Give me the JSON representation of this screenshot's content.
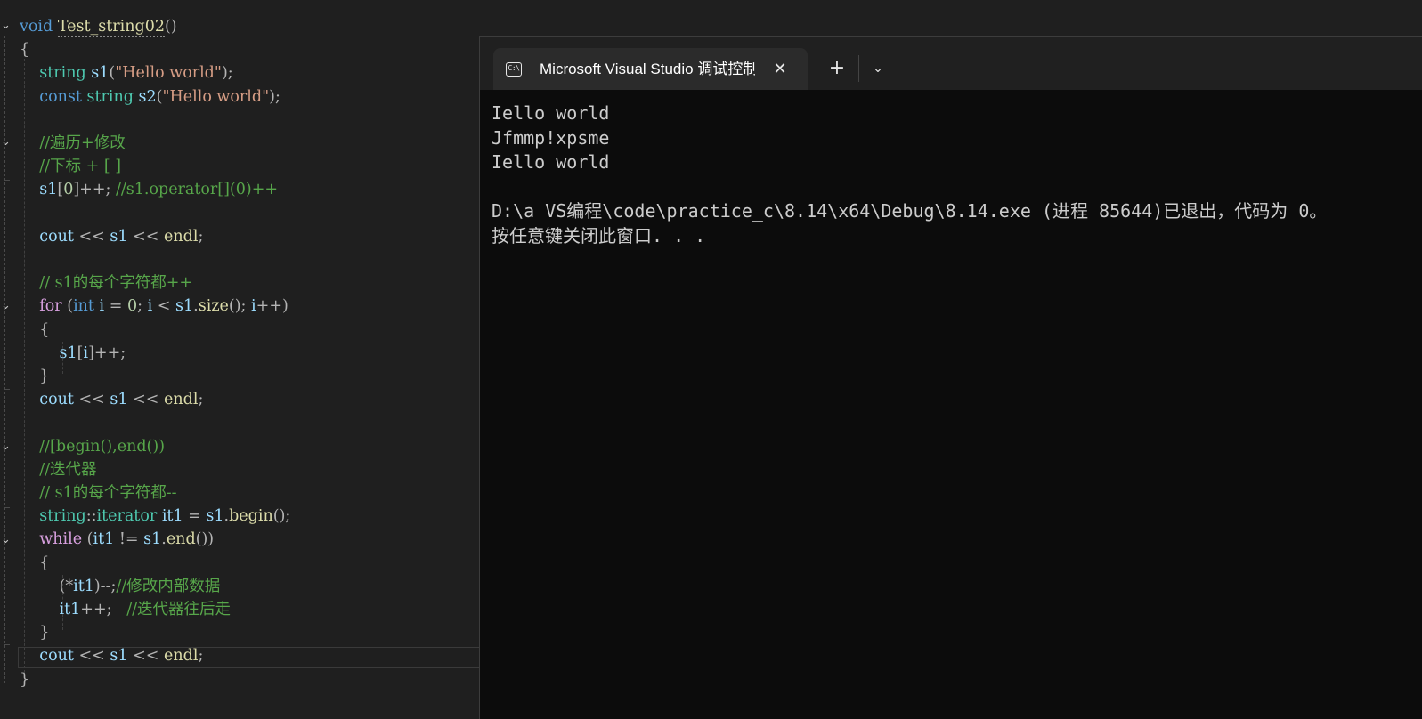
{
  "editor": {
    "lines": [
      [
        {
          "c": "kw",
          "t": "void"
        },
        {
          "c": "",
          "t": " "
        },
        {
          "c": "fn fn-underline",
          "t": "Test_string02"
        },
        {
          "c": "op",
          "t": "()"
        }
      ],
      [
        {
          "c": "op",
          "t": "{"
        }
      ],
      [
        {
          "c": "",
          "t": "    "
        },
        {
          "c": "ty",
          "t": "string"
        },
        {
          "c": "",
          "t": " "
        },
        {
          "c": "var",
          "t": "s1"
        },
        {
          "c": "op",
          "t": "("
        },
        {
          "c": "str",
          "t": "\"Hello world\""
        },
        {
          "c": "op",
          "t": ");"
        }
      ],
      [
        {
          "c": "",
          "t": "    "
        },
        {
          "c": "kw",
          "t": "const"
        },
        {
          "c": "",
          "t": " "
        },
        {
          "c": "ty",
          "t": "string"
        },
        {
          "c": "",
          "t": " "
        },
        {
          "c": "var",
          "t": "s2"
        },
        {
          "c": "op",
          "t": "("
        },
        {
          "c": "str",
          "t": "\"Hello world\""
        },
        {
          "c": "op",
          "t": ");"
        }
      ],
      [],
      [
        {
          "c": "",
          "t": "    "
        },
        {
          "c": "cm",
          "t": "//遍历+修改"
        }
      ],
      [
        {
          "c": "",
          "t": "    "
        },
        {
          "c": "cm",
          "t": "//下标 + [ ]"
        }
      ],
      [
        {
          "c": "",
          "t": "    "
        },
        {
          "c": "var",
          "t": "s1"
        },
        {
          "c": "op",
          "t": "["
        },
        {
          "c": "num",
          "t": "0"
        },
        {
          "c": "op",
          "t": "]++; "
        },
        {
          "c": "cm",
          "t": "//s1.operator[](0)++"
        }
      ],
      [],
      [
        {
          "c": "",
          "t": "    "
        },
        {
          "c": "var",
          "t": "cout"
        },
        {
          "c": "",
          "t": " "
        },
        {
          "c": "op",
          "t": "<<"
        },
        {
          "c": "",
          "t": " "
        },
        {
          "c": "var",
          "t": "s1"
        },
        {
          "c": "",
          "t": " "
        },
        {
          "c": "op",
          "t": "<<"
        },
        {
          "c": "",
          "t": " "
        },
        {
          "c": "fn",
          "t": "endl"
        },
        {
          "c": "op",
          "t": ";"
        }
      ],
      [],
      [
        {
          "c": "",
          "t": "    "
        },
        {
          "c": "cm",
          "t": "// s1的每个字符都++"
        }
      ],
      [
        {
          "c": "",
          "t": "    "
        },
        {
          "c": "ctl",
          "t": "for"
        },
        {
          "c": "",
          "t": " "
        },
        {
          "c": "op",
          "t": "("
        },
        {
          "c": "kw",
          "t": "int"
        },
        {
          "c": "",
          "t": " "
        },
        {
          "c": "var",
          "t": "i"
        },
        {
          "c": "",
          "t": " "
        },
        {
          "c": "op",
          "t": "="
        },
        {
          "c": "",
          "t": " "
        },
        {
          "c": "num",
          "t": "0"
        },
        {
          "c": "op",
          "t": ";"
        },
        {
          "c": "",
          "t": " "
        },
        {
          "c": "var",
          "t": "i"
        },
        {
          "c": "",
          "t": " "
        },
        {
          "c": "op",
          "t": "<"
        },
        {
          "c": "",
          "t": " "
        },
        {
          "c": "var",
          "t": "s1"
        },
        {
          "c": "op",
          "t": "."
        },
        {
          "c": "fn",
          "t": "size"
        },
        {
          "c": "op",
          "t": "();"
        },
        {
          "c": "",
          "t": " "
        },
        {
          "c": "var",
          "t": "i"
        },
        {
          "c": "op",
          "t": "++)"
        }
      ],
      [
        {
          "c": "",
          "t": "    "
        },
        {
          "c": "op",
          "t": "{"
        }
      ],
      [
        {
          "c": "",
          "t": "        "
        },
        {
          "c": "var",
          "t": "s1"
        },
        {
          "c": "op",
          "t": "["
        },
        {
          "c": "var",
          "t": "i"
        },
        {
          "c": "op",
          "t": "]++;"
        }
      ],
      [
        {
          "c": "",
          "t": "    "
        },
        {
          "c": "op",
          "t": "}"
        }
      ],
      [
        {
          "c": "",
          "t": "    "
        },
        {
          "c": "var",
          "t": "cout"
        },
        {
          "c": "",
          "t": " "
        },
        {
          "c": "op",
          "t": "<<"
        },
        {
          "c": "",
          "t": " "
        },
        {
          "c": "var",
          "t": "s1"
        },
        {
          "c": "",
          "t": " "
        },
        {
          "c": "op",
          "t": "<<"
        },
        {
          "c": "",
          "t": " "
        },
        {
          "c": "fn",
          "t": "endl"
        },
        {
          "c": "op",
          "t": ";"
        }
      ],
      [],
      [
        {
          "c": "",
          "t": "    "
        },
        {
          "c": "cm",
          "t": "//[begin(),end())"
        }
      ],
      [
        {
          "c": "",
          "t": "    "
        },
        {
          "c": "cm",
          "t": "//迭代器"
        }
      ],
      [
        {
          "c": "",
          "t": "    "
        },
        {
          "c": "cm",
          "t": "// s1的每个字符都--"
        }
      ],
      [
        {
          "c": "",
          "t": "    "
        },
        {
          "c": "ty",
          "t": "string"
        },
        {
          "c": "op",
          "t": "::"
        },
        {
          "c": "ty",
          "t": "iterator"
        },
        {
          "c": "",
          "t": " "
        },
        {
          "c": "var",
          "t": "it1"
        },
        {
          "c": "",
          "t": " "
        },
        {
          "c": "op",
          "t": "="
        },
        {
          "c": "",
          "t": " "
        },
        {
          "c": "var",
          "t": "s1"
        },
        {
          "c": "op",
          "t": "."
        },
        {
          "c": "fn",
          "t": "begin"
        },
        {
          "c": "op",
          "t": "();"
        }
      ],
      [
        {
          "c": "",
          "t": "    "
        },
        {
          "c": "ctl",
          "t": "while"
        },
        {
          "c": "",
          "t": " "
        },
        {
          "c": "op",
          "t": "("
        },
        {
          "c": "var",
          "t": "it1"
        },
        {
          "c": "",
          "t": " "
        },
        {
          "c": "op",
          "t": "!="
        },
        {
          "c": "",
          "t": " "
        },
        {
          "c": "var",
          "t": "s1"
        },
        {
          "c": "op",
          "t": "."
        },
        {
          "c": "fn",
          "t": "end"
        },
        {
          "c": "op",
          "t": "())"
        }
      ],
      [
        {
          "c": "",
          "t": "    "
        },
        {
          "c": "op",
          "t": "{"
        }
      ],
      [
        {
          "c": "",
          "t": "        "
        },
        {
          "c": "op",
          "t": "(*"
        },
        {
          "c": "var",
          "t": "it1"
        },
        {
          "c": "op",
          "t": ")--;"
        },
        {
          "c": "cm",
          "t": "//修改内部数据"
        }
      ],
      [
        {
          "c": "",
          "t": "        "
        },
        {
          "c": "var",
          "t": "it1"
        },
        {
          "c": "op",
          "t": "++;"
        },
        {
          "c": "",
          "t": "   "
        },
        {
          "c": "cm",
          "t": "//迭代器往后走"
        }
      ],
      [
        {
          "c": "",
          "t": "    "
        },
        {
          "c": "op",
          "t": "}"
        }
      ],
      [
        {
          "c": "",
          "t": "    "
        },
        {
          "c": "var",
          "t": "cout"
        },
        {
          "c": "",
          "t": " "
        },
        {
          "c": "op",
          "t": "<<"
        },
        {
          "c": "",
          "t": " "
        },
        {
          "c": "var",
          "t": "s1"
        },
        {
          "c": "",
          "t": " "
        },
        {
          "c": "op",
          "t": "<<"
        },
        {
          "c": "",
          "t": " "
        },
        {
          "c": "fn",
          "t": "endl"
        },
        {
          "c": "op",
          "t": ";"
        }
      ],
      [
        {
          "c": "op",
          "t": "}"
        }
      ]
    ]
  },
  "terminal": {
    "tab_icon_text": "C:\\",
    "tab_title": "Microsoft Visual Studio 调试控制台",
    "close_glyph": "✕",
    "new_tab_glyph": "+",
    "dropdown_glyph": "⌄",
    "output": [
      "Iello world",
      "Jfmmp!xpsme",
      "Iello world",
      "",
      "D:\\a VS编程\\code\\practice_c\\8.14\\x64\\Debug\\8.14.exe (进程 85644)已退出，代码为 0。",
      "按任意键关闭此窗口. . ."
    ]
  }
}
